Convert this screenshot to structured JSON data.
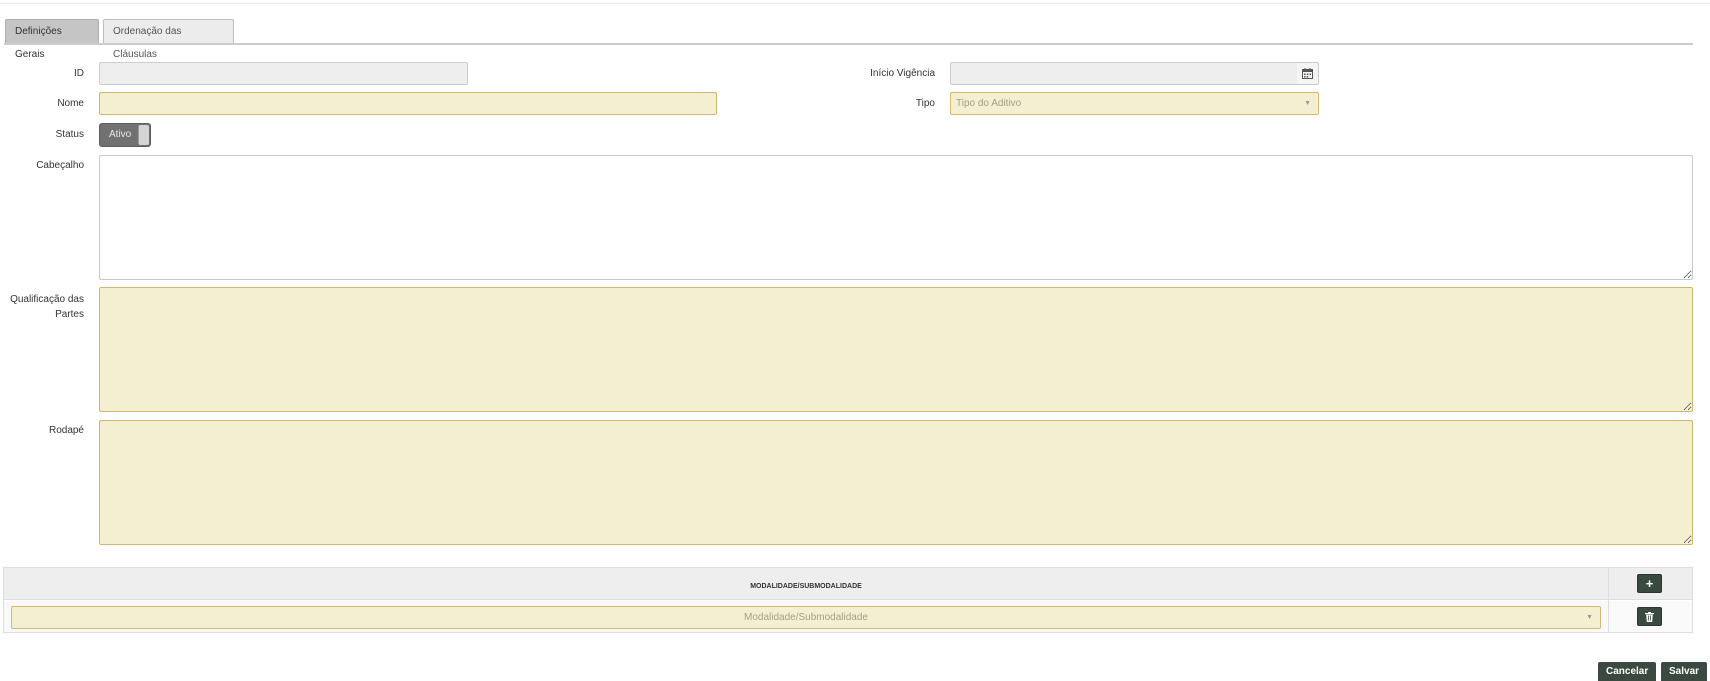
{
  "tabs": [
    {
      "label": "Definições Gerais",
      "active": true
    },
    {
      "label": "Ordenação das Cláusulas",
      "active": false
    }
  ],
  "form": {
    "id": {
      "label": "ID",
      "value": ""
    },
    "inicio_vigencia": {
      "label": "Início Vigência",
      "value": ""
    },
    "nome": {
      "label": "Nome",
      "value": ""
    },
    "tipo": {
      "label": "Tipo",
      "placeholder": "Tipo do Aditivo"
    },
    "status": {
      "label": "Status",
      "value": "Ativo"
    },
    "cabecalho": {
      "label": "Cabeçalho",
      "value": ""
    },
    "qualificacao": {
      "label_line1": "Qualificação das",
      "label_line2": "Partes",
      "value": ""
    },
    "rodape": {
      "label": "Rodapé",
      "value": ""
    }
  },
  "grid": {
    "header": "MODALIDADE/SUBMODALIDADE",
    "row_placeholder": "Modalidade/Submodalidade",
    "add_icon": "plus-icon",
    "delete_icon": "trash-icon"
  },
  "actions": {
    "cancel_label": "Cancelar",
    "save_label": "Salvar"
  },
  "colors": {
    "required_field_bg": "#f5efd2",
    "required_field_border": "#d3b772",
    "button_bg": "#3b4a40",
    "toggle_bg": "#717171"
  }
}
